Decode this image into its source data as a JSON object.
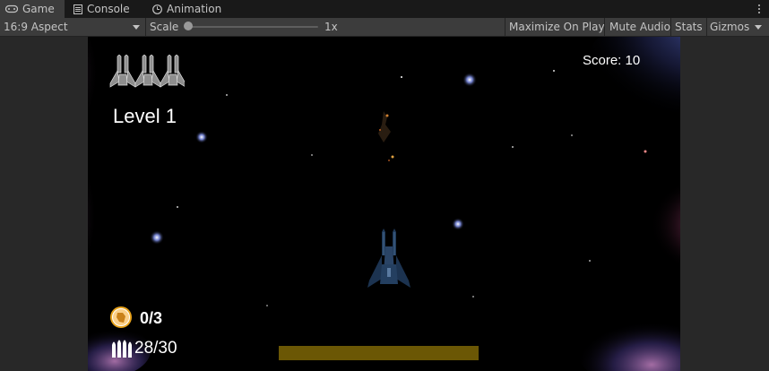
{
  "tabs": [
    {
      "label": "Game",
      "icon": "gamepad-icon",
      "active": true
    },
    {
      "label": "Console",
      "icon": "console-icon",
      "active": false
    },
    {
      "label": "Animation",
      "icon": "animation-clock-icon",
      "active": false
    }
  ],
  "toolbar": {
    "aspect": "16:9 Aspect",
    "scale_label": "Scale",
    "scale_value": "1x",
    "maximize_label": "Maximize On Play",
    "mute_label": "Mute Audio",
    "stats_label": "Stats",
    "gizmos_label": "Gizmos"
  },
  "game": {
    "score": "Score: 10",
    "level": "Level 1",
    "lives": 3,
    "coins": "0/3",
    "ammo": "28/30",
    "charge_fraction": 1.0,
    "colors": {
      "background": "#000000",
      "charge_bar": "#6b5705",
      "text": "#ffffff"
    }
  }
}
